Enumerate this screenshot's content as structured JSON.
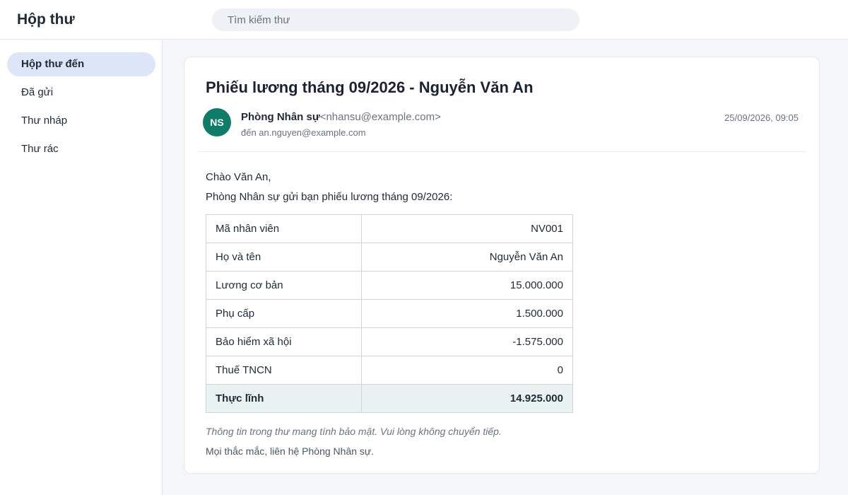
{
  "app": {
    "title": "Hộp thư"
  },
  "search": {
    "placeholder": "Tìm kiếm thư"
  },
  "sidebar": {
    "items": [
      {
        "label": "Hộp thư đến",
        "active": true
      },
      {
        "label": "Đã gửi",
        "active": false
      },
      {
        "label": "Thư nháp",
        "active": false
      },
      {
        "label": "Thư rác",
        "active": false
      }
    ]
  },
  "email": {
    "subject": "Phiếu lương tháng 09/2026 - Nguyễn Văn An",
    "avatar_initials": "NS",
    "avatar_color": "#0e7c66",
    "sender_name": "Phòng Nhân sự",
    "sender_email": "<nhansu@example.com>",
    "to": "đến an.nguyen@example.com",
    "date": "25/09/2026, 09:05",
    "greeting": "Chào Văn An,",
    "intro": "Phòng Nhân sự gửi bạn phiếu lương tháng 09/2026:",
    "payslip": [
      {
        "label": "Mã nhân viên",
        "value": "NV001"
      },
      {
        "label": "Họ và tên",
        "value": "Nguyễn Văn An"
      },
      {
        "label": "Lương cơ bản",
        "value": "15.000.000"
      },
      {
        "label": "Phụ cấp",
        "value": "1.500.000"
      },
      {
        "label": "Bảo hiểm xã hội",
        "value": "-1.575.000"
      },
      {
        "label": "Thuế TNCN",
        "value": "0"
      },
      {
        "label": "Thực lĩnh",
        "value": "14.925.000"
      }
    ],
    "note": "Thông tin trong thư mang tính bảo mật. Vui lòng không chuyển tiếp.",
    "contact": "Mọi thắc mắc, liên hệ Phòng Nhân sự."
  }
}
